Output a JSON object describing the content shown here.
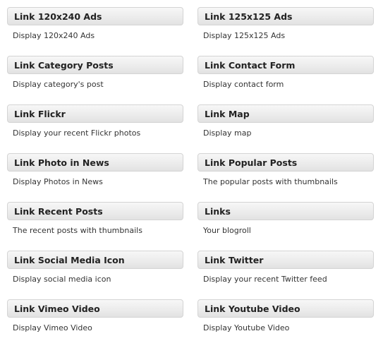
{
  "widgets": [
    {
      "title": "Link 120x240 Ads",
      "description": "Display 120x240 Ads"
    },
    {
      "title": "Link 125x125 Ads",
      "description": "Display 125x125 Ads"
    },
    {
      "title": "Link Category Posts",
      "description": "Display category's post"
    },
    {
      "title": "Link Contact Form",
      "description": "Display contact form"
    },
    {
      "title": "Link Flickr",
      "description": "Display your recent Flickr photos"
    },
    {
      "title": "Link Map",
      "description": "Display map"
    },
    {
      "title": "Link Photo in News",
      "description": "Display Photos in News"
    },
    {
      "title": "Link Popular Posts",
      "description": "The popular posts with thumbnails"
    },
    {
      "title": "Link Recent Posts",
      "description": "The recent posts with thumbnails"
    },
    {
      "title": "Links",
      "description": "Your blogroll"
    },
    {
      "title": "Link Social Media Icon",
      "description": "Display social media icon"
    },
    {
      "title": "Link Twitter",
      "description": "Display your recent Twitter feed"
    },
    {
      "title": "Link Vimeo Video",
      "description": "Display Vimeo Video"
    },
    {
      "title": "Link Youtube Video",
      "description": "Display Youtube Video"
    }
  ]
}
